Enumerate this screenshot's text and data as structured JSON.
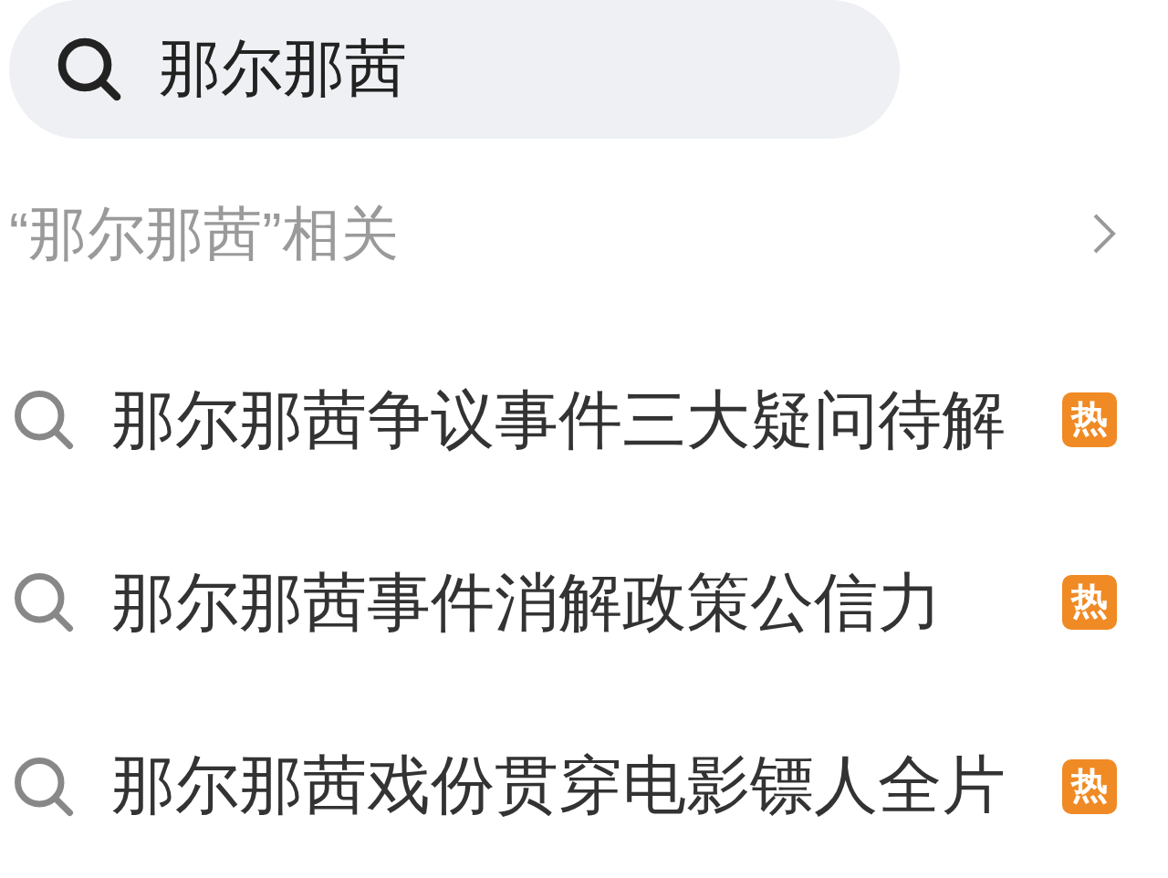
{
  "search": {
    "value": "那尔那茜"
  },
  "related": {
    "label": "“那尔那茜”相关"
  },
  "suggestions": [
    {
      "text": "那尔那茜争议事件三大疑问待解",
      "badge": "热"
    },
    {
      "text": "那尔那茜事件消解政策公信力",
      "badge": "热"
    },
    {
      "text": "那尔那茜戏份贯穿电影镖人全片",
      "badge": "热"
    }
  ]
}
